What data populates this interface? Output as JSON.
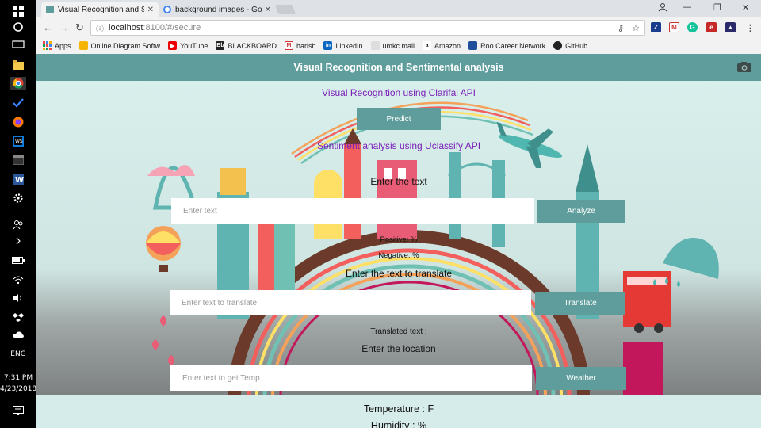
{
  "browser": {
    "tabs": [
      {
        "label": "Visual Recognition and S",
        "active": true,
        "favicon_color": "#5e9d9b"
      },
      {
        "label": "background images - Go",
        "active": false,
        "favicon_color": "#4285f4"
      }
    ],
    "url_host": "localhost",
    "url_path": ":8100/#/secure",
    "bookmarks": [
      {
        "label": "Apps",
        "icon": "apps-grid-icon",
        "color": "#e66"
      },
      {
        "label": "Online Diagram Softw",
        "icon": "bulb-icon",
        "color": "#f5b400"
      },
      {
        "label": "YouTube",
        "icon": "youtube-icon",
        "color": "#e00"
      },
      {
        "label": "BLACKBOARD",
        "icon": "blackboard-icon",
        "color": "#222"
      },
      {
        "label": "harish",
        "icon": "gmail-icon",
        "color": "#c33"
      },
      {
        "label": "LinkedIn",
        "icon": "linkedin-icon",
        "color": "#0a66c2"
      },
      {
        "label": "umkc  mail",
        "icon": "umkc-icon",
        "color": "#555"
      },
      {
        "label": "Amazon",
        "icon": "amazon-icon",
        "color": "#222"
      },
      {
        "label": "Roo Career Network",
        "icon": "roo-icon",
        "color": "#1f4e9c"
      },
      {
        "label": "GitHub",
        "icon": "github-icon",
        "color": "#222"
      }
    ]
  },
  "taskbar": {
    "time": "7:31 PM",
    "date": "4/23/2018",
    "lang": "ENG"
  },
  "app": {
    "title": "Visual Recognition and Sentimental analysis",
    "visual_heading": "Visual Recognition using Clarifai API",
    "predict_label": "Predict",
    "sentiment_heading": "Sentiment analysis using Uclassify API",
    "enter_text_label": "Enter the text",
    "text_placeholder": "Enter text",
    "analyze_label": "Analyze",
    "positive_label": "Positive: %",
    "negative_label": "Negative: %",
    "translate_heading": "Enter the text to translate",
    "translate_placeholder": "Enter text to translate",
    "translate_label": "Translate",
    "translated_label": "Translated text :",
    "location_heading": "Enter the location",
    "temp_placeholder": "Enter text to get Temp",
    "weather_label": "Weather",
    "temperature_label": "Temperature : F",
    "humidity_label": "Humidity : %"
  },
  "colors": {
    "accent": "#5e9d9b",
    "heading_purple": "#7a1fb8",
    "background": "#d6ecea"
  }
}
